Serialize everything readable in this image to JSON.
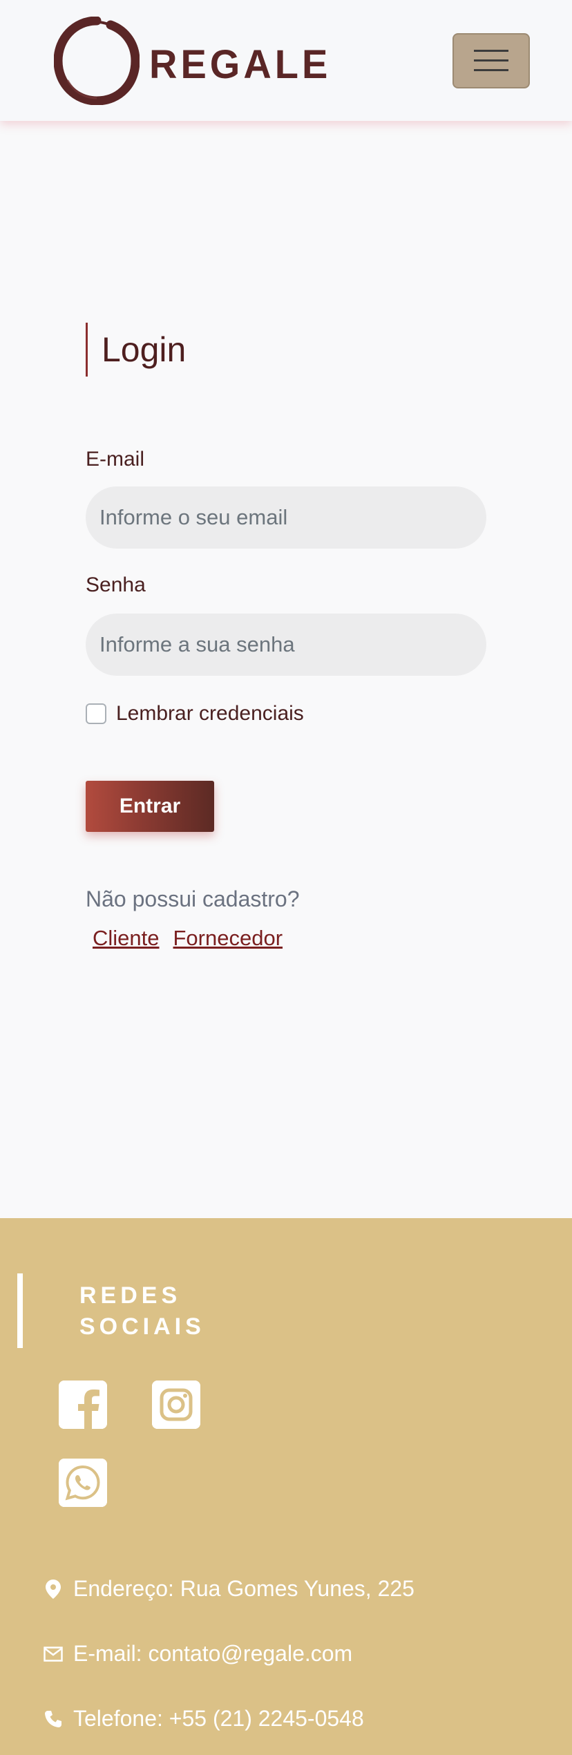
{
  "header": {
    "brand_name": "REGALE",
    "menu_icon": "hamburger-icon"
  },
  "login": {
    "title": "Login",
    "email_label": "E-mail",
    "email_placeholder": "Informe o seu email",
    "password_label": "Senha",
    "password_placeholder": "Informe a sua senha",
    "remember_label": "Lembrar credenciais",
    "submit_label": "Entrar",
    "no_account_text": "Não possui cadastro?",
    "register_links": [
      "Cliente",
      "Fornecedor"
    ]
  },
  "footer": {
    "social_heading": "REDES SOCIAIS",
    "social_icons": [
      "facebook-icon",
      "instagram-icon",
      "whatsapp-icon"
    ],
    "address": "Endereço: Rua Gomes Yunes, 225",
    "email": "E-mail: contato@regale.com",
    "phone": "Telefone: +55 (21) 2245-0548"
  },
  "colors": {
    "brand_dark": "#5a2626",
    "menu_button": "#b8a58d",
    "footer_bg": "#dbc187",
    "button_gradient_start": "#b24b3e",
    "button_gradient_end": "#5c2a24",
    "link": "#7a1f1f"
  }
}
